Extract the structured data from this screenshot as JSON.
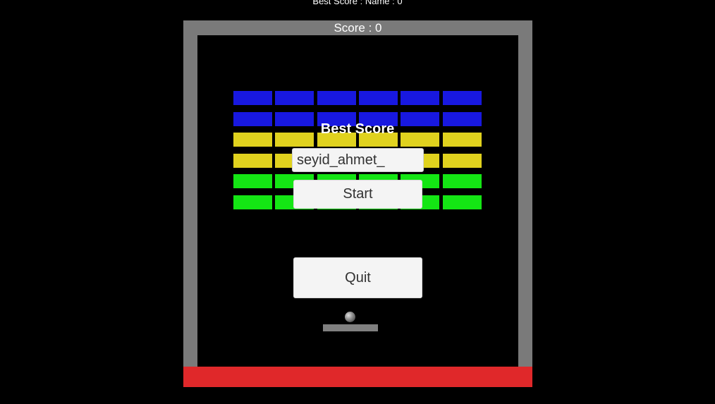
{
  "header": {
    "best_score_line": "Best Score : Name : 0"
  },
  "game": {
    "score_label": "Score : 0",
    "colors": {
      "wall": "#7a7a7a",
      "floor": "#e0282a",
      "paddle": "#808080",
      "background": "#000000"
    },
    "brick_rows": [
      {
        "color": "#1818e0",
        "count": 6
      },
      {
        "color": "#1818e0",
        "count": 6
      },
      {
        "color": "#e0d21e",
        "count": 6
      },
      {
        "color": "#e0d21e",
        "count": 6
      },
      {
        "color": "#14e614",
        "count": 6
      },
      {
        "color": "#14e614",
        "count": 6
      }
    ]
  },
  "menu": {
    "title": "Best Score",
    "name_input_value": "seyid_ahmet_",
    "start_label": "Start",
    "quit_label": "Quit"
  }
}
